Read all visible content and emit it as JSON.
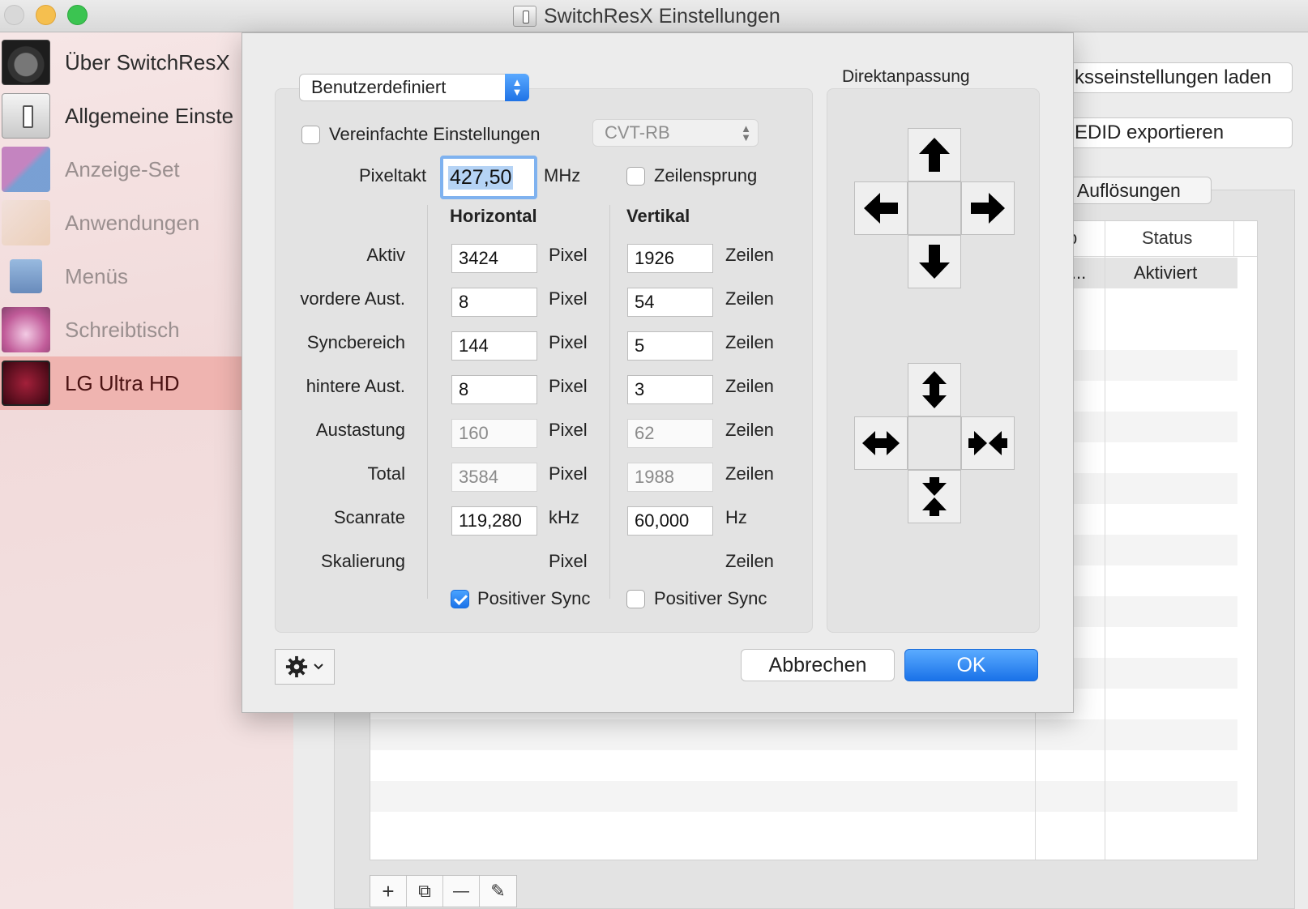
{
  "window": {
    "title": "SwitchResX Einstellungen"
  },
  "sidebar": {
    "items": [
      {
        "label": "Über SwitchResX",
        "icon": "switchresx-about-icon"
      },
      {
        "label": "Allgemeine Einste",
        "icon": "general-settings-icon"
      },
      {
        "label": "Anzeige-Set",
        "icon": "display-set-icon"
      },
      {
        "label": "Anwendungen",
        "icon": "applications-icon"
      },
      {
        "label": "Menüs",
        "icon": "menus-icon"
      },
      {
        "label": "Schreibtisch",
        "icon": "desktop-icon"
      },
      {
        "label": "LG Ultra HD",
        "icon": "lg-monitor-icon",
        "selected": true
      }
    ]
  },
  "background": {
    "load_button": "ksseinstellungen laden",
    "edid_button": "EDID exportieren",
    "tab_label": "e Auflösungen",
    "table": {
      "col_fragment": "p",
      "status_header": "Status",
      "row_fragment": "i...",
      "row_status": "Aktiviert"
    },
    "toolbar": {
      "add": "+",
      "duplicate": "⧉",
      "remove": "—",
      "edit": "✎"
    }
  },
  "dialog": {
    "preset": "Benutzerdefiniert",
    "simplified_label": "Vereinfachte Einstellungen",
    "timing_standard": "CVT-RB",
    "pixelclock_label": "Pixeltakt",
    "pixelclock_value": "427,50",
    "pixelclock_unit": "MHz",
    "interlace_label": "Zeilensprung",
    "horizontal_header": "Horizontal",
    "vertical_header": "Vertikal",
    "rows": [
      {
        "label": "Aktiv",
        "h": "3424",
        "h_unit": "Pixel",
        "v": "1926",
        "v_unit": "Zeilen"
      },
      {
        "label": "vordere Aust.",
        "h": "8",
        "h_unit": "Pixel",
        "v": "54",
        "v_unit": "Zeilen"
      },
      {
        "label": "Syncbereich",
        "h": "144",
        "h_unit": "Pixel",
        "v": "5",
        "v_unit": "Zeilen"
      },
      {
        "label": "hintere Aust.",
        "h": "8",
        "h_unit": "Pixel",
        "v": "3",
        "v_unit": "Zeilen"
      },
      {
        "label": "Austastung",
        "h": "160",
        "h_unit": "Pixel",
        "v": "62",
        "v_unit": "Zeilen"
      },
      {
        "label": "Total",
        "h": "3584",
        "h_unit": "Pixel",
        "v": "1988",
        "v_unit": "Zeilen"
      },
      {
        "label": "Scanrate",
        "h": "119,280",
        "h_unit": "kHz",
        "v": "60,000",
        "v_unit": "Hz"
      },
      {
        "label": "Skalierung",
        "h_unit": "Pixel",
        "v_unit": "Zeilen"
      }
    ],
    "h_positive_sync": "Positiver Sync",
    "v_positive_sync": "Positiver Sync",
    "direct_adjust_label": "Direktanpassung",
    "cancel_label": "Abbrechen",
    "ok_label": "OK"
  },
  "colors": {
    "accent": "#1a72e8",
    "sidebar_selected": "#efb4b0"
  }
}
